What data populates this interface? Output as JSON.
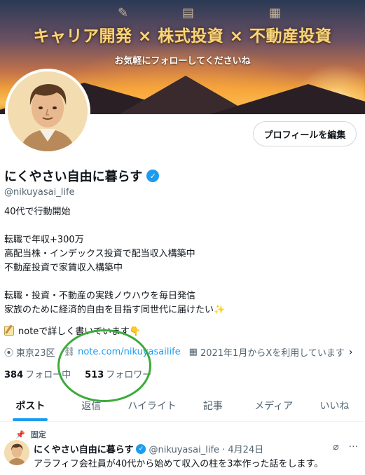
{
  "banner": {
    "title": "キャリア開発 × 株式投資 × 不動産投資",
    "subtitle": "お気軽にフォローしてくださいね"
  },
  "profile": {
    "edit_button": "プロフィールを編集",
    "display_name": "にくやさい自由に暮らす",
    "handle": "@nikuyasai_life",
    "bio": "40代で行動開始\n\n転職で年収+300万\n高配当株・インデックス投資で配当収入構築中\n不動産投資で家賃収入構築中\n\n転職・投資・不動産の実践ノウハウを毎日発信\n家族のために経済的自由を目指す同世代に届けたい✨",
    "note_line": "noteで詳しく書いています👇",
    "location": "東京23区",
    "link": "note.com/nikuyasailife",
    "joined": "2021年1月からXを利用しています",
    "following_count": "384",
    "following_label": "フォロー中",
    "followers_count": "513",
    "followers_label": "フォロワー"
  },
  "tabs": [
    {
      "label": "ポスト",
      "active": true
    },
    {
      "label": "返信"
    },
    {
      "label": "ハイライト"
    },
    {
      "label": "記事"
    },
    {
      "label": "メディア"
    },
    {
      "label": "いいね"
    }
  ],
  "pinned": {
    "label": "固定",
    "name": "にくやさい自由に暮らす",
    "meta": "@nikuyasai_life · 4月24日",
    "text": "アラフィフ会社員が40代から始めて収入の柱を3本作った話をします。"
  },
  "colors": {
    "accent": "#1d9bf0",
    "annotation": "#3cab3a"
  },
  "icons": {
    "location": "location-pin-icon",
    "link": "link-icon",
    "calendar": "calendar-icon",
    "pin": "pin-icon",
    "grok": "grok-icon",
    "more": "more-icon"
  }
}
